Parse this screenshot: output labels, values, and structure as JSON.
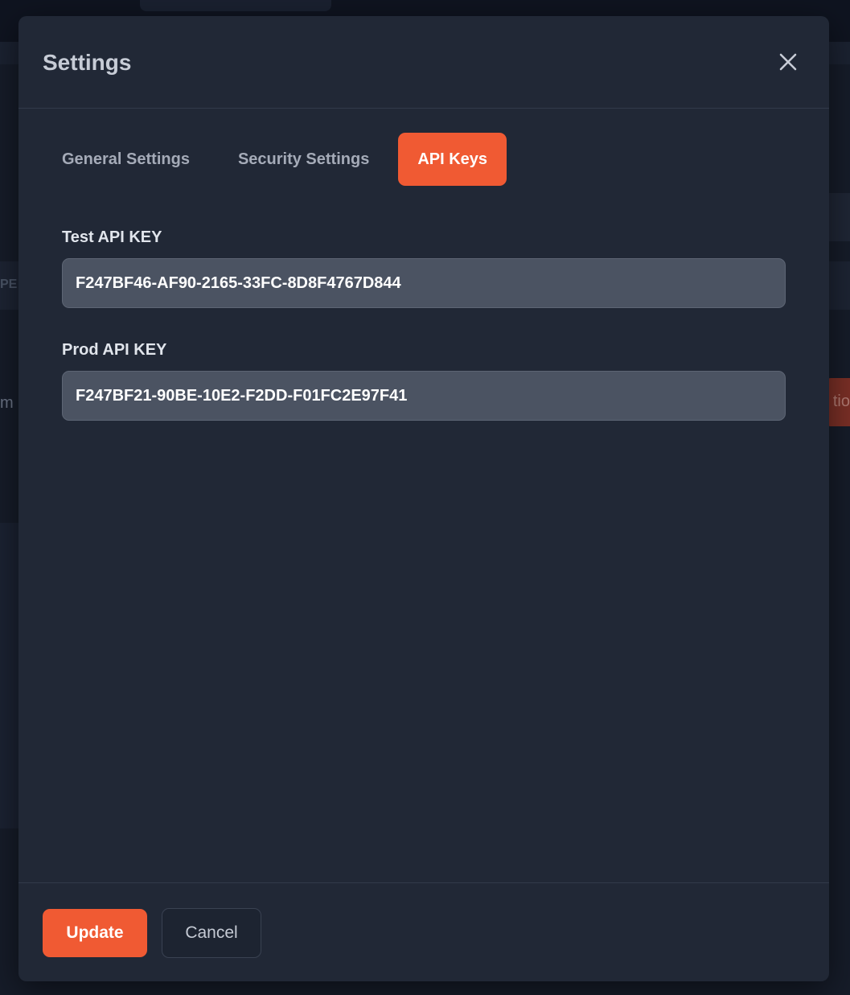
{
  "background": {
    "left_fragment_1": "PE",
    "left_fragment_2": "m",
    "right_fragment": "tio"
  },
  "modal": {
    "title": "Settings",
    "close_icon": "close-icon",
    "tabs": [
      {
        "label": "General Settings",
        "active": false
      },
      {
        "label": "Security Settings",
        "active": false
      },
      {
        "label": "API Keys",
        "active": true
      }
    ],
    "fields": {
      "test_key": {
        "label": "Test API KEY",
        "value": "F247BF46-AF90-2165-33FC-8D8F4767D844"
      },
      "prod_key": {
        "label": "Prod API KEY",
        "value": "F247BF21-90BE-10E2-F2DD-F01FC2E97F41"
      }
    },
    "footer": {
      "update_label": "Update",
      "cancel_label": "Cancel"
    }
  },
  "colors": {
    "accent": "#f05a33",
    "modal_bg": "#212836",
    "input_bg": "#4b5362"
  }
}
